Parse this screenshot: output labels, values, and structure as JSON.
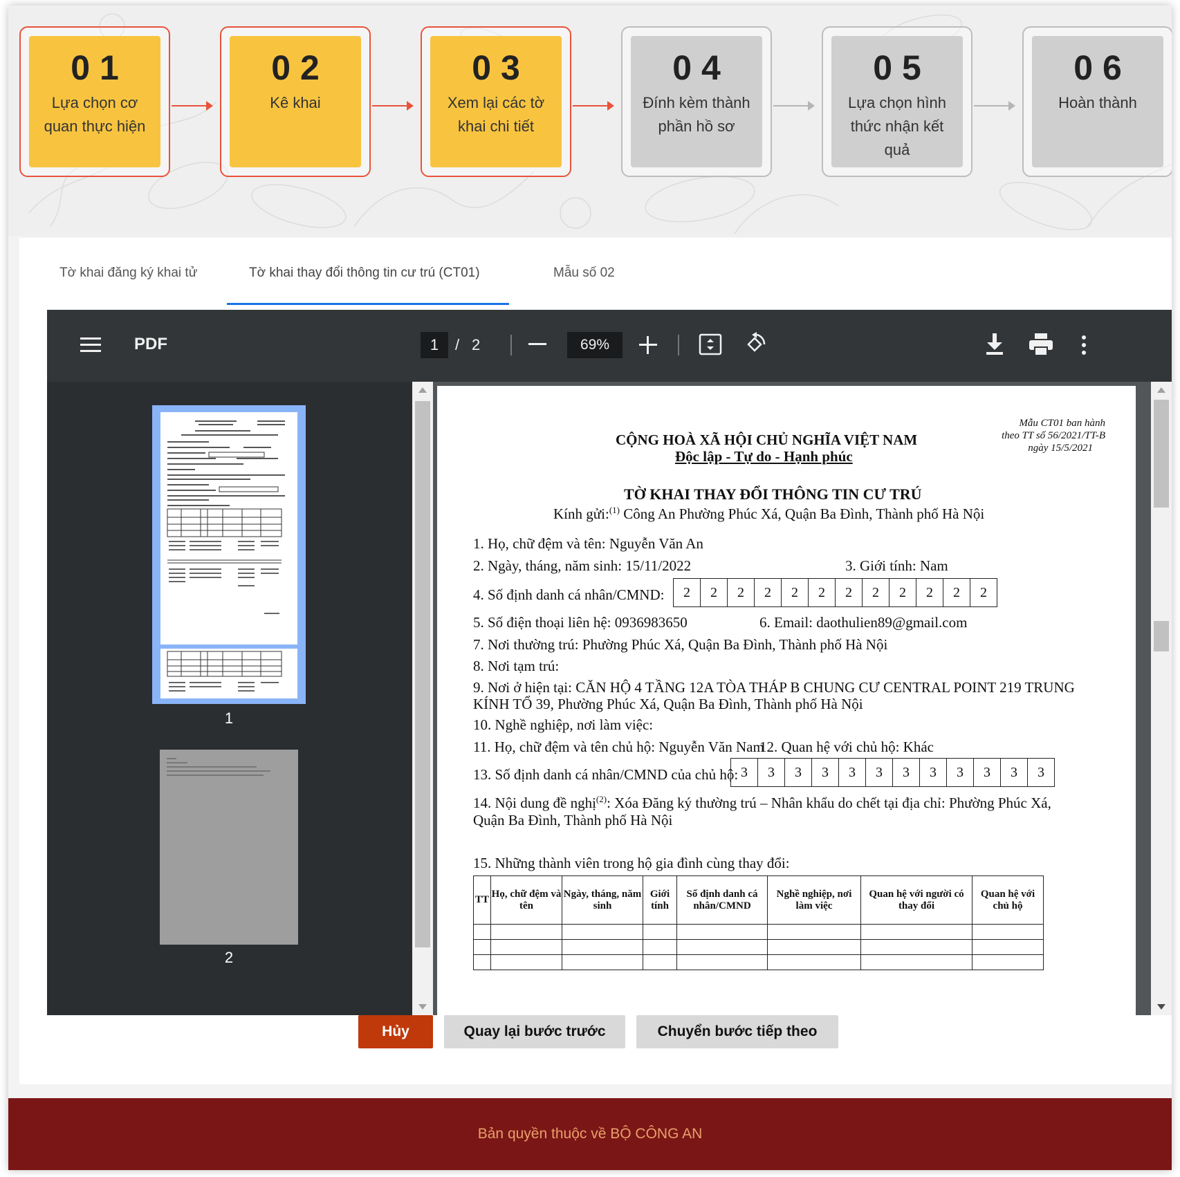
{
  "steps": [
    {
      "num": "01",
      "label": "Lựa chọn cơ quan thực hiện",
      "active": true
    },
    {
      "num": "02",
      "label": "Kê khai",
      "active": true
    },
    {
      "num": "03",
      "label": "Xem lại các tờ khai chi tiết",
      "active": true
    },
    {
      "num": "04",
      "label": "Đính kèm thành phần hồ sơ",
      "active": false
    },
    {
      "num": "05",
      "label": "Lựa chọn hình thức nhận kết quả",
      "active": false
    },
    {
      "num": "06",
      "label": "Hoàn thành",
      "active": false
    }
  ],
  "tabs": [
    "Tờ khai đăng ký khai tử",
    "Tờ khai thay đổi thông tin cư trú (CT01)",
    "Mẫu số 02"
  ],
  "active_tab": 1,
  "viewer": {
    "title": "PDF",
    "page_current": "1",
    "page_sep": "/",
    "page_total": "2",
    "zoom": "69%",
    "thumb_labels": [
      "1",
      "2"
    ]
  },
  "doc": {
    "form_note_1": "Mẫu CT01 ban hành",
    "form_note_2": "theo TT số 56/2021/TT-B",
    "form_note_3": "ngày 15/5/2021",
    "nation": "CỘNG HOÀ XÃ HỘI CHỦ NGHĨA VIỆT NAM",
    "motto": "Độc lập - Tự do - Hạnh phúc",
    "doc_title": "TỜ KHAI THAY ĐỔI THÔNG TIN CƯ TRÚ",
    "recipient_prefix": "Kính gửi:",
    "recipient_sup": "(1)",
    "recipient": " Công An Phường Phúc Xá, Quận Ba Đình, Thành phố Hà Nội",
    "f1": "1. Họ, chữ đệm và tên: Nguyễn Văn An",
    "f2": "2. Ngày, tháng, năm sinh: 15/11/2022",
    "f3": "3. Giới tính: Nam",
    "f4": "4. Số định danh cá nhân/CMND:",
    "f4_digits": [
      "2",
      "2",
      "2",
      "2",
      "2",
      "2",
      "2",
      "2",
      "2",
      "2",
      "2",
      "2"
    ],
    "f5": "5. Số điện thoại liên hệ: 0936983650",
    "f6": "6. Email: daothulien89@gmail.com",
    "f7": "7. Nơi thường trú: Phường Phúc Xá, Quận Ba Đình, Thành phố Hà Nội",
    "f8": "8. Nơi tạm trú:",
    "f9a": "9. Nơi ở hiện tại: CĂN HỘ 4 TẦNG 12A TÒA THÁP B CHUNG CƯ CENTRAL POINT 219 TRUNG",
    "f9b": "KÍNH TỔ 39, Phường Phúc Xá, Quận Ba Đình, Thành phố Hà Nội",
    "f10": "10. Nghề nghiệp, nơi làm việc:",
    "f11": "11. Họ, chữ đệm và tên chủ hộ: Nguyễn Văn Nam",
    "f12": "12. Quan hệ với chủ hộ: Khác",
    "f13": "13. Số định danh cá nhân/CMND của chủ hộ:",
    "f13_digits": [
      "3",
      "3",
      "3",
      "3",
      "3",
      "3",
      "3",
      "3",
      "3",
      "3",
      "3",
      "3"
    ],
    "f14a_prefix": "14. Nội dung đề nghị",
    "f14a_sup": "(2)",
    "f14a_rest": ": Xóa Đăng ký thường trú – Nhân khẩu do chết tại địa chỉ: Phường Phúc Xá,",
    "f14b": "Quận Ba Đình, Thành phố Hà Nội",
    "f15": "15. Những thành viên trong hộ gia đình cùng thay đổi:",
    "table_headers": [
      "TT",
      "Họ, chữ đệm và tên",
      "Ngày, tháng, năm sinh",
      "Giới tính",
      "Số định danh cá nhân/CMND",
      "Nghề nghiệp, nơi làm việc",
      "Quan hệ với người có thay đổi",
      "Quan hệ với chủ hộ"
    ]
  },
  "buttons": {
    "cancel": "Hủy",
    "back": "Quay lại bước trước",
    "next": "Chuyển bước tiếp theo"
  },
  "footer": "Bản quyền thuộc về BỘ CÔNG AN",
  "colors": {
    "accent_orange": "#e8533a",
    "step_active": "#f8c440",
    "step_inactive": "#cfcfcf",
    "tab_active": "#1a73e8",
    "cancel_button": "#c0390b",
    "footer_bg": "#7b1616",
    "footer_text": "#e8a06a"
  }
}
